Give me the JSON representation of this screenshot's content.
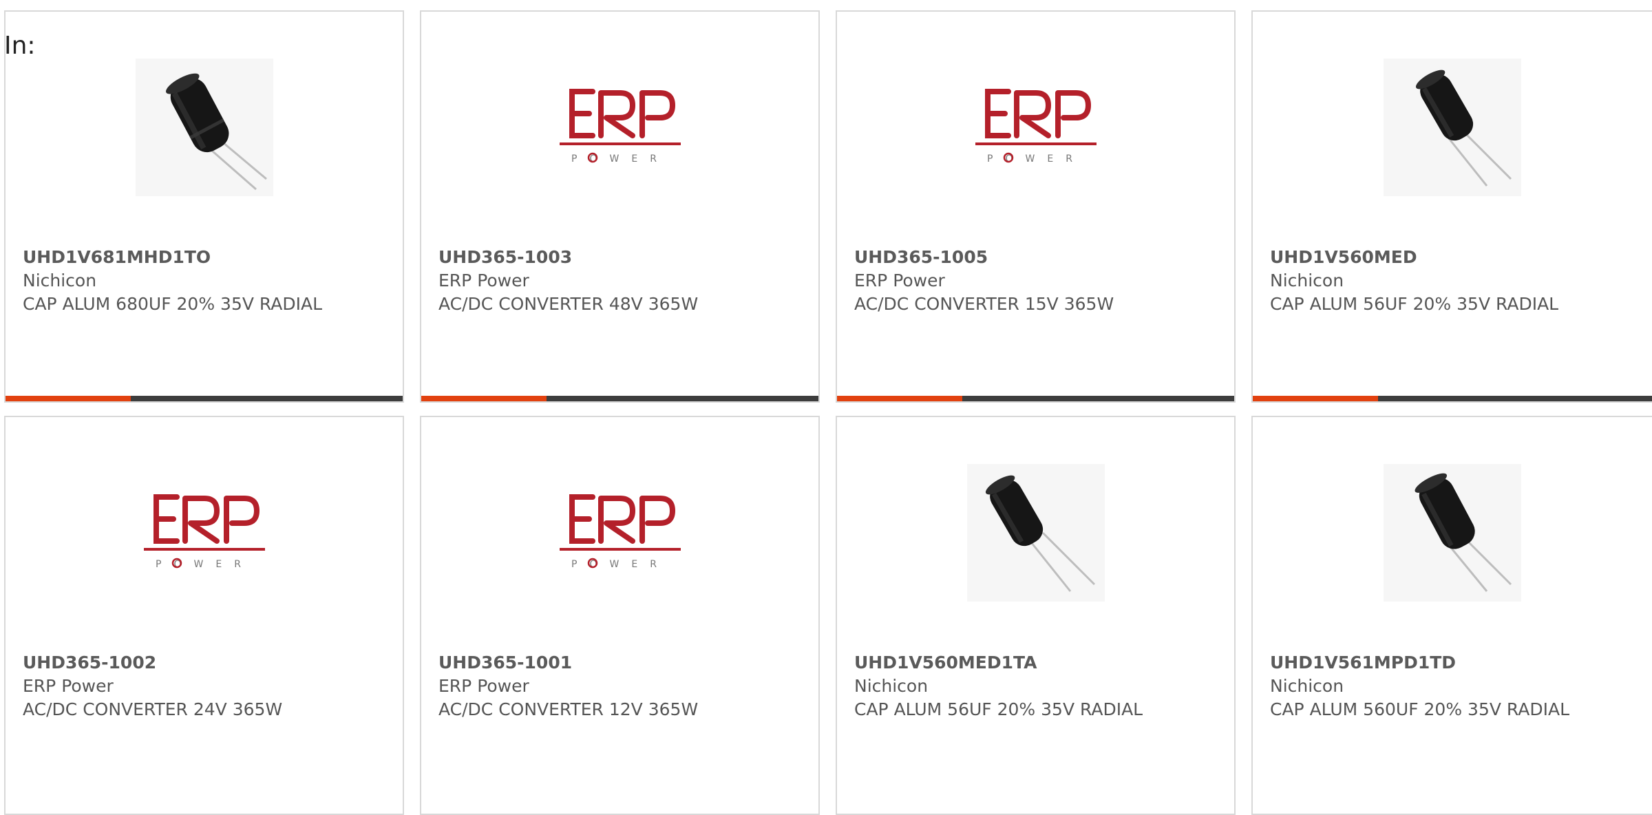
{
  "header": {
    "in_label": "In:"
  },
  "products": [
    {
      "part_number": "UHD1V681MHD1TO",
      "manufacturer": "Nichicon",
      "description": "CAP ALUM 680UF 20% 35V RADIAL",
      "image": "capacitor-icon"
    },
    {
      "part_number": "UHD365-1003",
      "manufacturer": "ERP Power",
      "description": "AC/DC CONVERTER 48V 365W",
      "image": "erp-power-logo"
    },
    {
      "part_number": "UHD365-1005",
      "manufacturer": "ERP Power",
      "description": "AC/DC CONVERTER 15V 365W",
      "image": "erp-power-logo"
    },
    {
      "part_number": "UHD1V560MED",
      "manufacturer": "Nichicon",
      "description": "CAP ALUM 56UF 20% 35V RADIAL",
      "image": "capacitor-icon"
    },
    {
      "part_number": "UHD365-1002",
      "manufacturer": "ERP Power",
      "description": "AC/DC CONVERTER 24V 365W",
      "image": "erp-power-logo"
    },
    {
      "part_number": "UHD365-1001",
      "manufacturer": "ERP Power",
      "description": "AC/DC CONVERTER 12V 365W",
      "image": "erp-power-logo"
    },
    {
      "part_number": "UHD1V560MED1TA",
      "manufacturer": "Nichicon",
      "description": "CAP ALUM 56UF 20% 35V RADIAL",
      "image": "capacitor-icon"
    },
    {
      "part_number": "UHD1V561MPD1TD",
      "manufacturer": "Nichicon",
      "description": "CAP ALUM 560UF 20% 35V RADIAL",
      "image": "capacitor-icon"
    }
  ],
  "logo": {
    "brand_text": "ERP",
    "sub_text": "POWER"
  },
  "colors": {
    "accent": "#e2410f",
    "bar_dark": "#3d3d3d",
    "erp_red": "#b4202a",
    "card_border": "#d8d8d8"
  }
}
